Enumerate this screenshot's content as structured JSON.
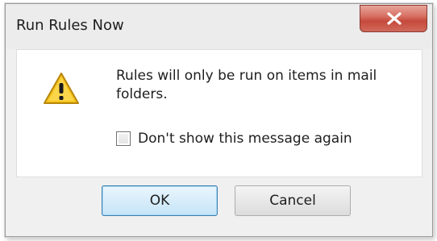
{
  "dialog": {
    "title": "Run Rules Now",
    "message": "Rules will only be run on items in mail folders.",
    "checkbox_label": "Don't show this message again",
    "checkbox_checked": false,
    "ok_label": "OK",
    "cancel_label": "Cancel",
    "close_icon": "close-icon",
    "warning_icon": "warning-icon"
  },
  "colors": {
    "close_button": "#c54a3b",
    "warning_fill": "#f7c51b",
    "ok_border": "#3c7fb1"
  }
}
